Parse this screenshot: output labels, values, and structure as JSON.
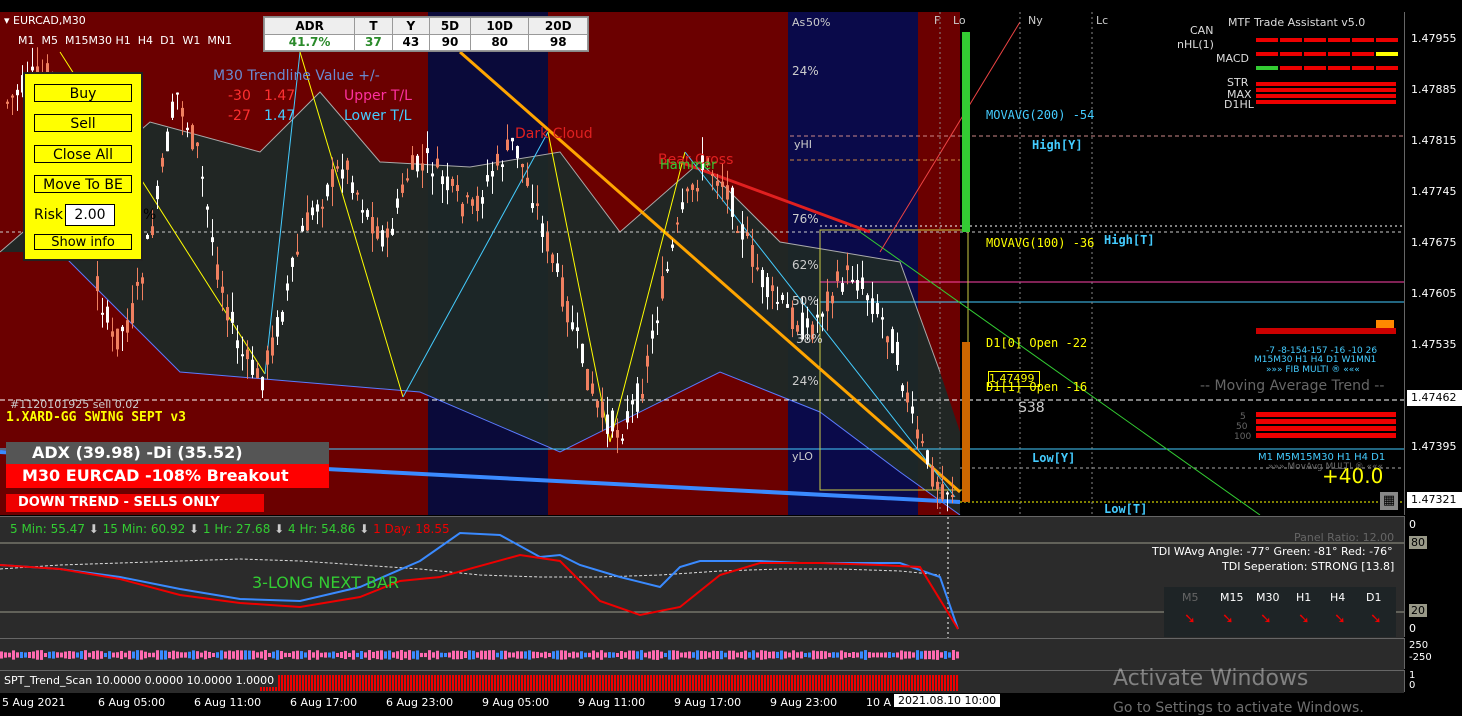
{
  "chart_header": {
    "symbol": "EURCAD,M30"
  },
  "timeframes": [
    "M1",
    "M5",
    "M15",
    "M30",
    "H1",
    "H4",
    "D1",
    "W1",
    "MN1"
  ],
  "stats": {
    "headers": [
      "ADR",
      "T",
      "Y",
      "5D",
      "10D",
      "20D"
    ],
    "values": [
      "41.7%",
      "37",
      "43",
      "90",
      "80",
      "98"
    ]
  },
  "trade_panel": {
    "buy": "Buy",
    "sell": "Sell",
    "close_all": "Close All",
    "move_to_be": "Move To BE",
    "risk_label": "Risk",
    "risk_value": "2.00",
    "risk_unit": "%",
    "show_info": "Show info"
  },
  "trendline": {
    "title": "M30 Trendline Value +/-",
    "upper_offset": "-30",
    "upper_value": "1.47",
    "upper_label": "Upper T/L",
    "lower_offset": "-27",
    "lower_value": "1.47",
    "lower_label": "Lower T/L"
  },
  "annotations": {
    "dark_cloud": "Dark Cloud",
    "bear_cross": "Bear Cross",
    "hammer": "Hammer",
    "pct_50": "50%",
    "pct_24a": "24%",
    "pct_76": "76%",
    "pct_62": "62%",
    "pct_50b": "50%",
    "pct_38": "38%",
    "pct_24b": "24%",
    "yhi": "yHI",
    "ylo": "yLO",
    "as": "As",
    "f": "F",
    "lo": "Lo",
    "ny": "Ny",
    "lc": "Lc",
    "movavg200": "MOVAVG(200) -54",
    "movavg100": "MOVAVG(100) -36",
    "high_y": "High[Y]",
    "high_t": "High[T]",
    "d1_open0": "D1[0] Open -22",
    "d1_open1": "D1[1] Open -16",
    "low_y": "Low[Y]",
    "low_t": "Low[T]",
    "s38": "S38",
    "ma_trend": "-- Moving Average Trend --",
    "plus40": "+40.0",
    "order_line": "#1120101925 sell 0.02",
    "price_tag": "1.47499"
  },
  "left_info": {
    "system": "1.XARD-GG SWING SEPT v3",
    "adx": "ADX (39.98) -Di (35.52)",
    "breakout": "M30 EURCAD -108% Breakout",
    "trend": "DOWN TREND - SELLS ONLY"
  },
  "right_panel": {
    "title": "MTF Trade Assistant v5.0",
    "rows": [
      "CAN",
      "nHL(1)",
      "MACD",
      "STR",
      "MAX",
      "D1HL"
    ],
    "fib_nums": "-7 -8-154-157 -16 -10 26",
    "fib_tfs": "M15M30 H1 H4 D1 W1MN1",
    "fib_label": "»»» FIB MULTI ® «««",
    "lvl_5": "5",
    "lvl_50": "50",
    "lvl_100": "100",
    "mtf_tfs": "M1 M5M15M30 H1 H4 D1",
    "mtf_label": "»»» MovAvg MULTI ® «««"
  },
  "price_axis": [
    "1.47955",
    "1.47885",
    "1.47815",
    "1.47745",
    "1.47675",
    "1.47605",
    "1.47535",
    "1.47462",
    "1.47395",
    "1.47321"
  ],
  "tdi": {
    "m5": "5 Min: 55.47",
    "m15": "15 Min: 60.92",
    "h1": "1 Hr: 27.68",
    "h4": "4 Hr: 54.86",
    "d1": "1 Day: 18.55",
    "long_next": "3-LONG NEXT BAR",
    "panel_ratio": "Panel Ratio: 12.00",
    "angle": "TDI WAvg Angle: -77°  Green: -81°  Red: -76°",
    "separation": "TDI Seperation: STRONG [13.8]",
    "tfs": [
      "M5",
      "M15",
      "M30",
      "H1",
      "H4",
      "D1"
    ],
    "axis": [
      "0",
      "80",
      "20",
      "0"
    ]
  },
  "histo": {
    "axis": [
      "250",
      "-250"
    ]
  },
  "scan": {
    "label": "SPT_Trend_Scan 10.0000 0.0000 10.0000 1.0000",
    "axis": [
      "1",
      "0"
    ]
  },
  "dates": [
    "5 Aug 2021",
    "6 Aug 05:00",
    "6 Aug 11:00",
    "6 Aug 17:00",
    "6 Aug 23:00",
    "9 Aug 05:00",
    "9 Aug 11:00",
    "9 Aug 17:00",
    "9 Aug 23:00",
    "10 A",
    "2021.08.10 10:00"
  ],
  "watermark": {
    "line1": "Activate Windows",
    "line2": "Go to Settings to activate Windows."
  },
  "colors": {
    "bg": "#2b2b2b",
    "bear": "#f08060",
    "bull": "#ffffff",
    "darkred": "#6b0000",
    "navy": "#000033"
  }
}
